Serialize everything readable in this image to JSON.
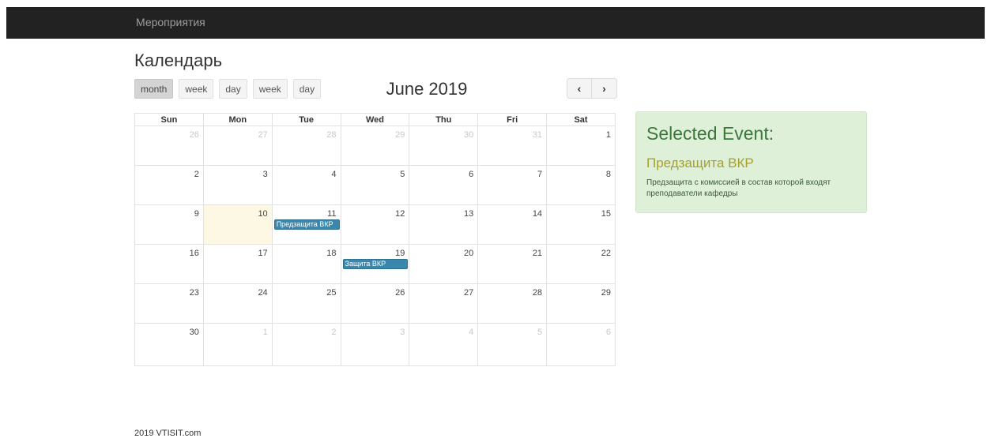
{
  "navbar": {
    "brand": "Мероприятия"
  },
  "page": {
    "title": "Календарь"
  },
  "toolbar": {
    "views": [
      "month",
      "week",
      "day",
      "week",
      "day"
    ],
    "active_view": "month",
    "title": "June 2019",
    "prev_icon": "‹",
    "next_icon": "›"
  },
  "calendar": {
    "weekdays": [
      "Sun",
      "Mon",
      "Tue",
      "Wed",
      "Thu",
      "Fri",
      "Sat"
    ],
    "weeks": [
      [
        {
          "d": "26",
          "o": true
        },
        {
          "d": "27",
          "o": true
        },
        {
          "d": "28",
          "o": true
        },
        {
          "d": "29",
          "o": true
        },
        {
          "d": "30",
          "o": true
        },
        {
          "d": "31",
          "o": true
        },
        {
          "d": "1"
        }
      ],
      [
        {
          "d": "2"
        },
        {
          "d": "3"
        },
        {
          "d": "4"
        },
        {
          "d": "5"
        },
        {
          "d": "6"
        },
        {
          "d": "7"
        },
        {
          "d": "8"
        }
      ],
      [
        {
          "d": "9"
        },
        {
          "d": "10",
          "today": true
        },
        {
          "d": "11",
          "event": "Предзащита ВКР"
        },
        {
          "d": "12"
        },
        {
          "d": "13"
        },
        {
          "d": "14"
        },
        {
          "d": "15"
        }
      ],
      [
        {
          "d": "16"
        },
        {
          "d": "17"
        },
        {
          "d": "18"
        },
        {
          "d": "19",
          "event": "Защита ВКР"
        },
        {
          "d": "20"
        },
        {
          "d": "21"
        },
        {
          "d": "22"
        }
      ],
      [
        {
          "d": "23"
        },
        {
          "d": "24"
        },
        {
          "d": "25"
        },
        {
          "d": "26"
        },
        {
          "d": "27"
        },
        {
          "d": "28"
        },
        {
          "d": "29"
        }
      ],
      [
        {
          "d": "30"
        },
        {
          "d": "1",
          "o": true
        },
        {
          "d": "2",
          "o": true
        },
        {
          "d": "3",
          "o": true
        },
        {
          "d": "4",
          "o": true
        },
        {
          "d": "5",
          "o": true
        },
        {
          "d": "6",
          "o": true
        }
      ]
    ],
    "event_color": "#3a87ad",
    "today_color": "#fcf8e3"
  },
  "selected_event": {
    "heading": "Selected Event:",
    "title": "Предзащита ВКР",
    "description": "Предзащита с комиссией в состав которой входят преподаватели кафедры"
  },
  "footer": {
    "text": "2019 VTISIT.com"
  }
}
